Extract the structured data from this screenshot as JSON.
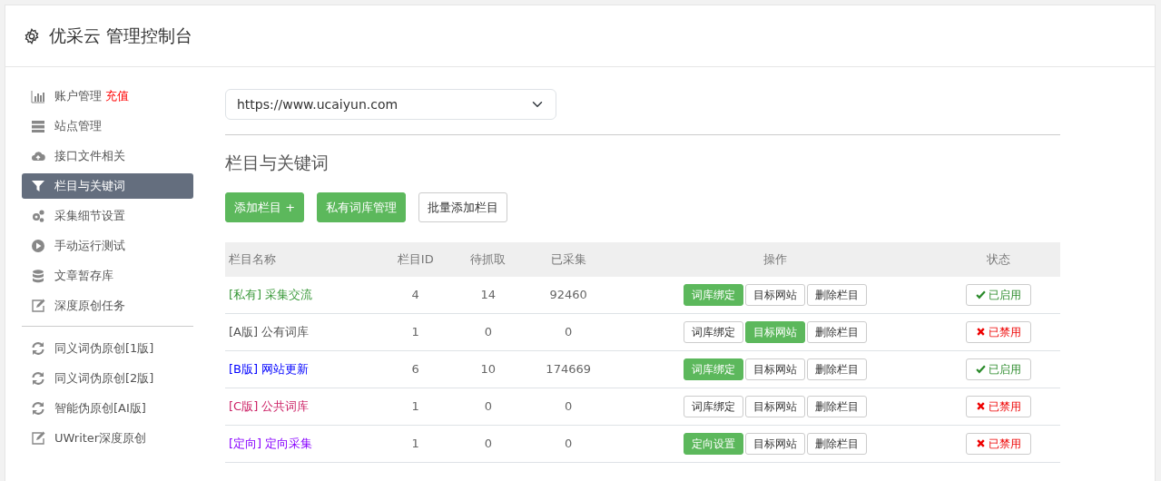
{
  "header": {
    "title": "优采云 管理控制台"
  },
  "sidebar": {
    "items": [
      {
        "label": "账户管理",
        "extra": "充值",
        "kind": "chart",
        "selected": false
      },
      {
        "label": "站点管理",
        "kind": "server",
        "selected": false
      },
      {
        "label": "接口文件相关",
        "kind": "cloud",
        "selected": false
      },
      {
        "label": "栏目与关键词",
        "kind": "filter",
        "selected": true
      },
      {
        "label": "采集细节设置",
        "kind": "gears",
        "selected": false
      },
      {
        "label": "手动运行测试",
        "kind": "play",
        "selected": false
      },
      {
        "label": "文章暂存库",
        "kind": "database",
        "selected": false
      },
      {
        "label": "深度原创任务",
        "kind": "edit",
        "selected": false
      }
    ],
    "items2": [
      {
        "label": "同义词伪原创[1版]",
        "kind": "refresh",
        "selected": false
      },
      {
        "label": "同义词伪原创[2版]",
        "kind": "refresh",
        "selected": false
      },
      {
        "label": "智能伪原创[AI版]",
        "kind": "refresh",
        "selected": false
      },
      {
        "label": "UWriter深度原创",
        "kind": "edit",
        "selected": false
      }
    ]
  },
  "site_select": {
    "value": "https://www.ucaiyun.com"
  },
  "section_title": "栏目与关键词",
  "toolbar": [
    {
      "label": "添加栏目 +",
      "primary": true
    },
    {
      "label": "私有词库管理",
      "primary": true
    },
    {
      "label": "批量添加栏目",
      "primary": false
    }
  ],
  "table": {
    "columns": [
      "栏目名称",
      "栏目ID",
      "待抓取",
      "已采集",
      "操作",
      "状态"
    ],
    "rows": [
      {
        "name": "[私有] 采集交流",
        "color": "#3c9a3c",
        "id": "4",
        "pending": "14",
        "collected": "92460",
        "actions": [
          {
            "label": "词库绑定",
            "active": true
          },
          {
            "label": "目标网站",
            "active": false
          },
          {
            "label": "删除栏目",
            "active": false
          }
        ],
        "status": {
          "label": "已启用",
          "enabled": true
        }
      },
      {
        "name": "[A版] 公有词库",
        "color": "#555555",
        "id": "1",
        "pending": "0",
        "collected": "0",
        "actions": [
          {
            "label": "词库绑定",
            "active": false
          },
          {
            "label": "目标网站",
            "active": true
          },
          {
            "label": "删除栏目",
            "active": false
          }
        ],
        "status": {
          "label": "已禁用",
          "enabled": false
        }
      },
      {
        "name": "[B版] 网站更新",
        "color": "#0000ff",
        "id": "6",
        "pending": "10",
        "collected": "174669",
        "actions": [
          {
            "label": "词库绑定",
            "active": true
          },
          {
            "label": "目标网站",
            "active": false
          },
          {
            "label": "删除栏目",
            "active": false
          }
        ],
        "status": {
          "label": "已启用",
          "enabled": true
        }
      },
      {
        "name": "[C版] 公共词库",
        "color": "#cc2266",
        "id": "1",
        "pending": "0",
        "collected": "0",
        "actions": [
          {
            "label": "词库绑定",
            "active": false
          },
          {
            "label": "目标网站",
            "active": false
          },
          {
            "label": "删除栏目",
            "active": false
          }
        ],
        "status": {
          "label": "已禁用",
          "enabled": false
        }
      },
      {
        "name": "[定向] 定向采集",
        "color": "#8800ff",
        "id": "1",
        "pending": "0",
        "collected": "0",
        "actions": [
          {
            "label": "定向设置",
            "active": true
          },
          {
            "label": "目标网站",
            "active": false
          },
          {
            "label": "删除栏目",
            "active": false
          }
        ],
        "status": {
          "label": "已禁用",
          "enabled": false
        }
      }
    ]
  }
}
